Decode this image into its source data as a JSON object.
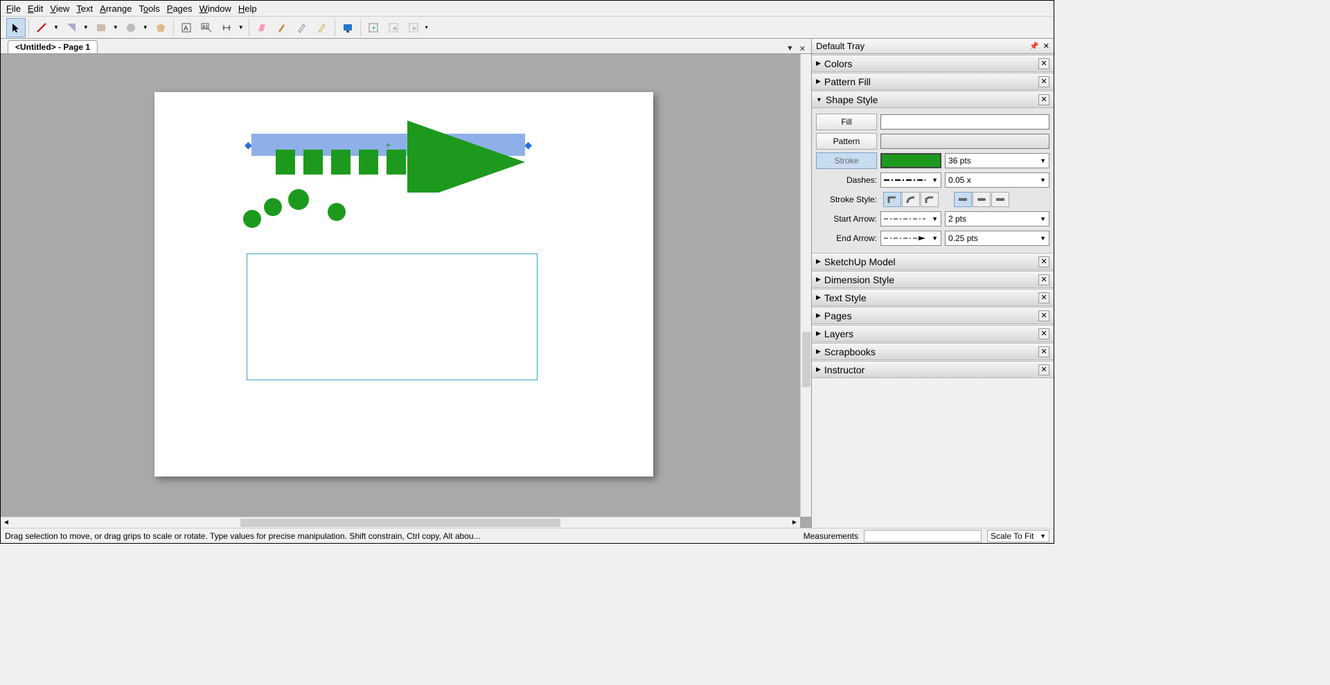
{
  "menu": [
    "File",
    "Edit",
    "View",
    "Text",
    "Arrange",
    "Tools",
    "Pages",
    "Window",
    "Help"
  ],
  "tab": {
    "title": "<Untitled> - Page 1"
  },
  "tray": {
    "title": "Default Tray",
    "panels": {
      "colors": "Colors",
      "pattern_fill": "Pattern Fill",
      "shape_style": "Shape Style",
      "sketchup_model": "SketchUp Model",
      "dimension_style": "Dimension Style",
      "text_style": "Text Style",
      "pages": "Pages",
      "layers": "Layers",
      "scrapbooks": "Scrapbooks",
      "instructor": "Instructor"
    },
    "shape_style": {
      "fill_label": "Fill",
      "pattern_label": "Pattern",
      "stroke_label": "Stroke",
      "stroke_size": "36 pts",
      "dashes_label": "Dashes:",
      "dashes_val": "0.05 x",
      "stroke_style_label": "Stroke Style:",
      "start_arrow_label": "Start Arrow:",
      "start_arrow_val": "2 pts",
      "end_arrow_label": "End Arrow:",
      "end_arrow_val": "0.25 pts"
    }
  },
  "status": {
    "hint": "Drag selection to move, or drag grips to scale or rotate. Type values for precise manipulation. Shift constrain, Ctrl copy, Alt abou...",
    "measurements_label": "Measurements",
    "zoom": "Scale To Fit"
  },
  "colors": {
    "green": "#1d9a1d",
    "selection": "#8db0e8",
    "teal": "#3ba3c6"
  }
}
